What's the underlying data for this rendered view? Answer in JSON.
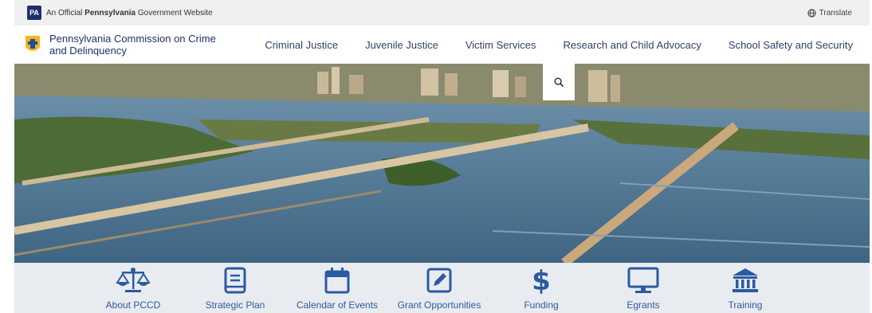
{
  "topbar": {
    "badge": "PA",
    "official_prefix": "An Official ",
    "official_bold": "Pennsylvania",
    "official_suffix": " Government Website",
    "translate_label": "Translate"
  },
  "header": {
    "org_name": "Pennsylvania Commission on Crime and Delinquency"
  },
  "nav": {
    "items": [
      {
        "label": "Criminal Justice"
      },
      {
        "label": "Juvenile Justice"
      },
      {
        "label": "Victim Services"
      },
      {
        "label": "Research and Child Advocacy"
      },
      {
        "label": "School Safety and Security"
      }
    ]
  },
  "quick_links": [
    {
      "label": "About PCCD",
      "icon": "scales-icon"
    },
    {
      "label": "Strategic Plan",
      "icon": "book-icon"
    },
    {
      "label": "Calendar of Events",
      "icon": "calendar-icon"
    },
    {
      "label": "Grant Opportunities",
      "icon": "pencil-square-icon"
    },
    {
      "label": "Funding",
      "icon": "dollar-icon"
    },
    {
      "label": "Egrants",
      "icon": "monitor-icon"
    },
    {
      "label": "Training",
      "icon": "institution-icon"
    }
  ],
  "colors": {
    "brand_navy": "#1f2f6e",
    "icon_blue": "#2c5aa0",
    "topbar_bg": "#f0f0f0",
    "iconbar_bg": "#e8ecf0"
  }
}
